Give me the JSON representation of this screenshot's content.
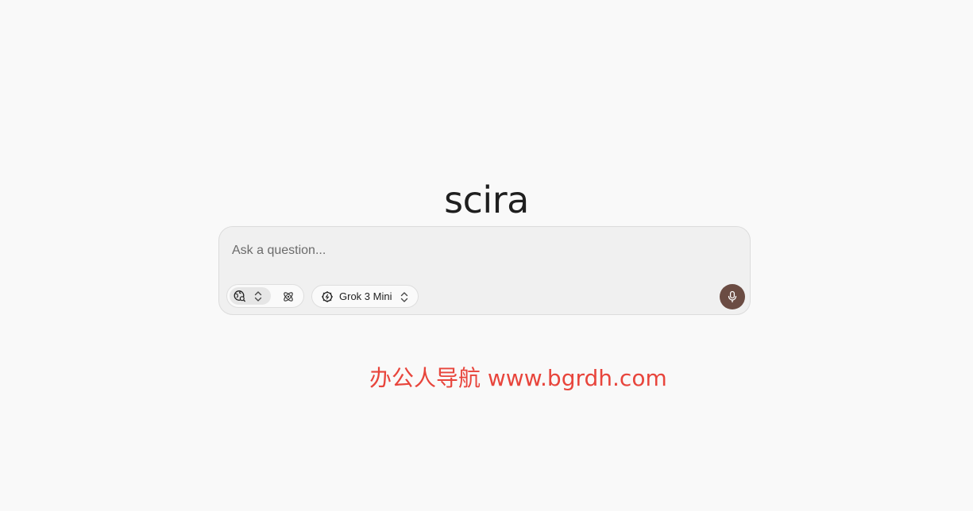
{
  "brand": {
    "logo_text": "scira"
  },
  "search": {
    "placeholder": "Ask a question...",
    "value": ""
  },
  "toolbar": {
    "group_mode": {
      "active_icon": "web-search-icon",
      "toggle_icon": "chevron-up-down-icon",
      "alt_icon": "atom-icon"
    },
    "model_selector": {
      "icon": "cpu-chip-icon",
      "label": "Grok 3 Mini",
      "chevron_icon": "chevron-up-down-icon"
    },
    "voice_button": {
      "icon": "microphone-icon",
      "color": "#6b4c43"
    }
  },
  "watermark": {
    "text": "办公人导航 www.bgrdh.com",
    "color": "#e8453c"
  }
}
